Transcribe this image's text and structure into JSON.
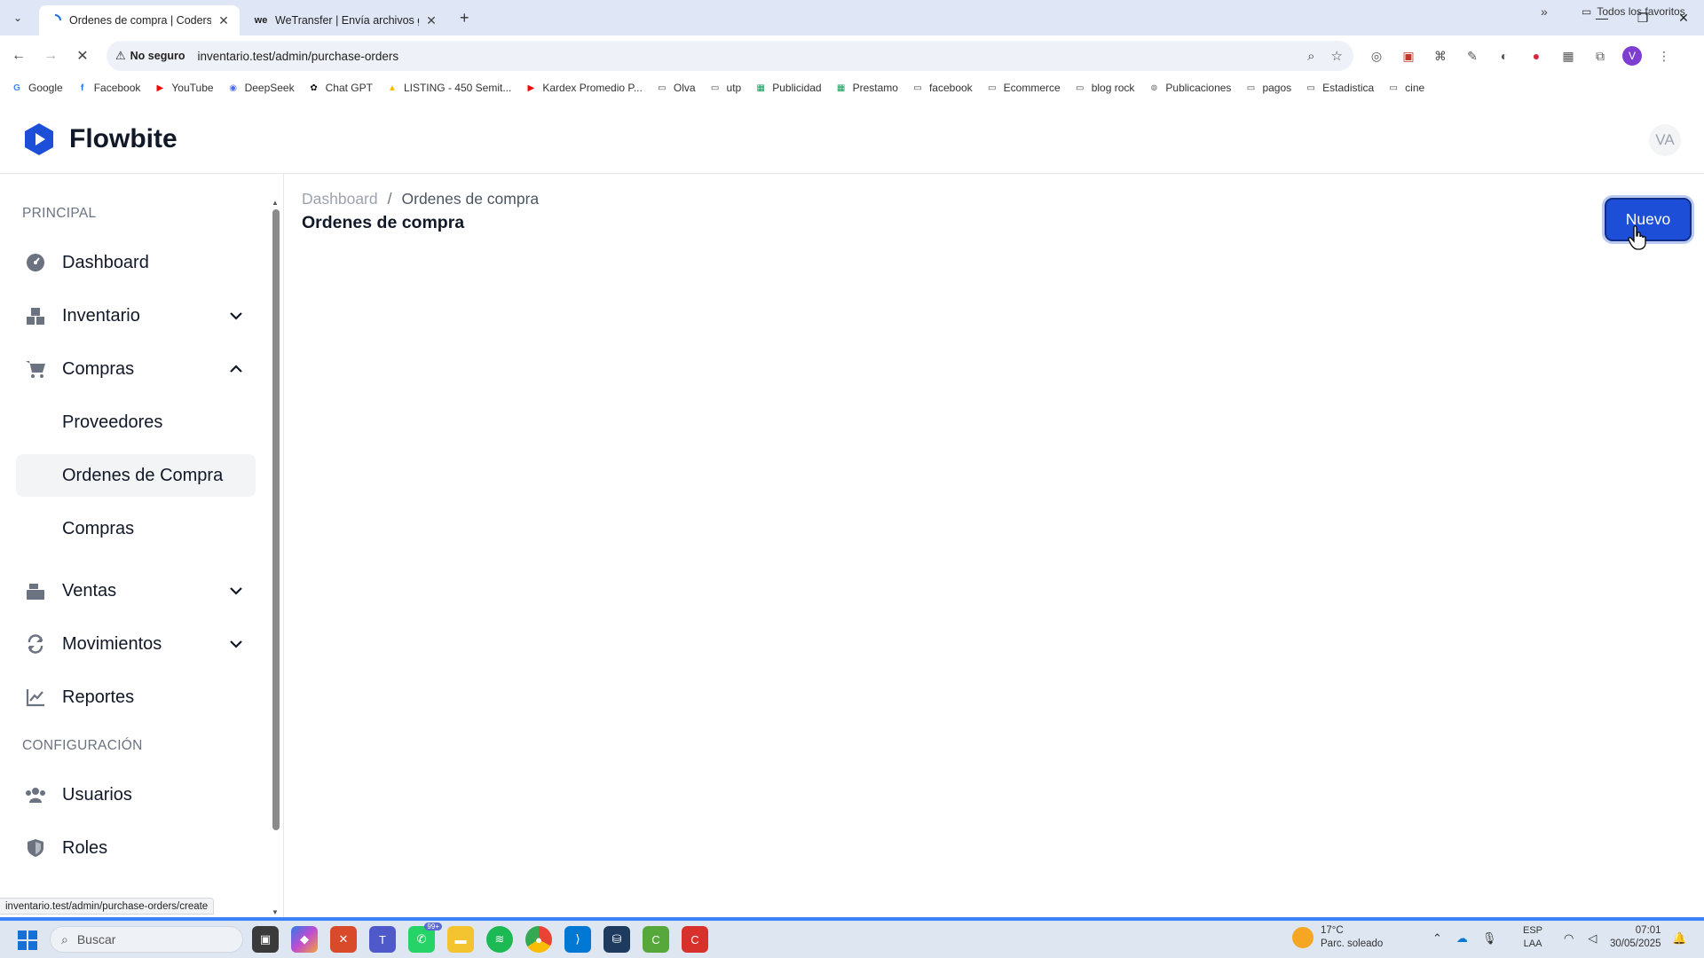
{
  "browser": {
    "tabs": [
      {
        "title": "Ordenes de compra | Codersfre",
        "active": true
      },
      {
        "title": "WeTransfer | Envía archivos gra",
        "active": false
      }
    ],
    "security_label": "No seguro",
    "url": "inventario.test/admin/purchase-orders",
    "profile_initial": "V",
    "bookmarks": [
      {
        "label": "Google",
        "icon": "google-icon"
      },
      {
        "label": "Facebook",
        "icon": "facebook-icon"
      },
      {
        "label": "YouTube",
        "icon": "youtube-icon"
      },
      {
        "label": "DeepSeek",
        "icon": "deepseek-icon"
      },
      {
        "label": "Chat GPT",
        "icon": "chatgpt-icon"
      },
      {
        "label": "LISTING - 450 Semit...",
        "icon": "drive-icon"
      },
      {
        "label": "Kardex Promedio P...",
        "icon": "youtube-icon"
      },
      {
        "label": "Olva",
        "icon": "folder-icon"
      },
      {
        "label": "utp",
        "icon": "folder-icon"
      },
      {
        "label": "Publicidad",
        "icon": "sheets-icon"
      },
      {
        "label": "Prestamo",
        "icon": "sheets-icon"
      },
      {
        "label": "facebook",
        "icon": "folder-icon"
      },
      {
        "label": "Ecommerce",
        "icon": "folder-icon"
      },
      {
        "label": "blog rock",
        "icon": "folder-icon"
      },
      {
        "label": "Publicaciones",
        "icon": "link-icon"
      },
      {
        "label": "pagos",
        "icon": "folder-icon"
      },
      {
        "label": "Estadistica",
        "icon": "folder-icon"
      },
      {
        "label": "cine",
        "icon": "folder-icon"
      }
    ],
    "all_bookmarks_label": "Todos los favoritos",
    "status_url": "inventario.test/admin/purchase-orders/create"
  },
  "app": {
    "brand": "Flowbite",
    "avatar_initials": "VA",
    "brand_color": "#1d4ed8"
  },
  "sidebar": {
    "section_main": "PRINCIPAL",
    "section_config": "CONFIGURACIÓN",
    "items": {
      "dashboard": "Dashboard",
      "inventario": "Inventario",
      "compras": "Compras",
      "proveedores": "Proveedores",
      "ordenes": "Ordenes de Compra",
      "compras_sub": "Compras",
      "ventas": "Ventas",
      "movimientos": "Movimientos",
      "reportes": "Reportes",
      "usuarios": "Usuarios",
      "roles": "Roles"
    }
  },
  "main": {
    "breadcrumb_root": "Dashboard",
    "breadcrumb_sep": "/",
    "breadcrumb_current": "Ordenes de compra",
    "title": "Ordenes de compra",
    "new_button": "Nuevo"
  },
  "taskbar": {
    "search_placeholder": "Buscar",
    "whatsapp_badge": "99+",
    "weather_temp": "17°C",
    "weather_desc": "Parc. soleado",
    "lang_top": "ESP",
    "lang_bottom": "LAA",
    "time": "07:01",
    "date": "30/05/2025"
  }
}
